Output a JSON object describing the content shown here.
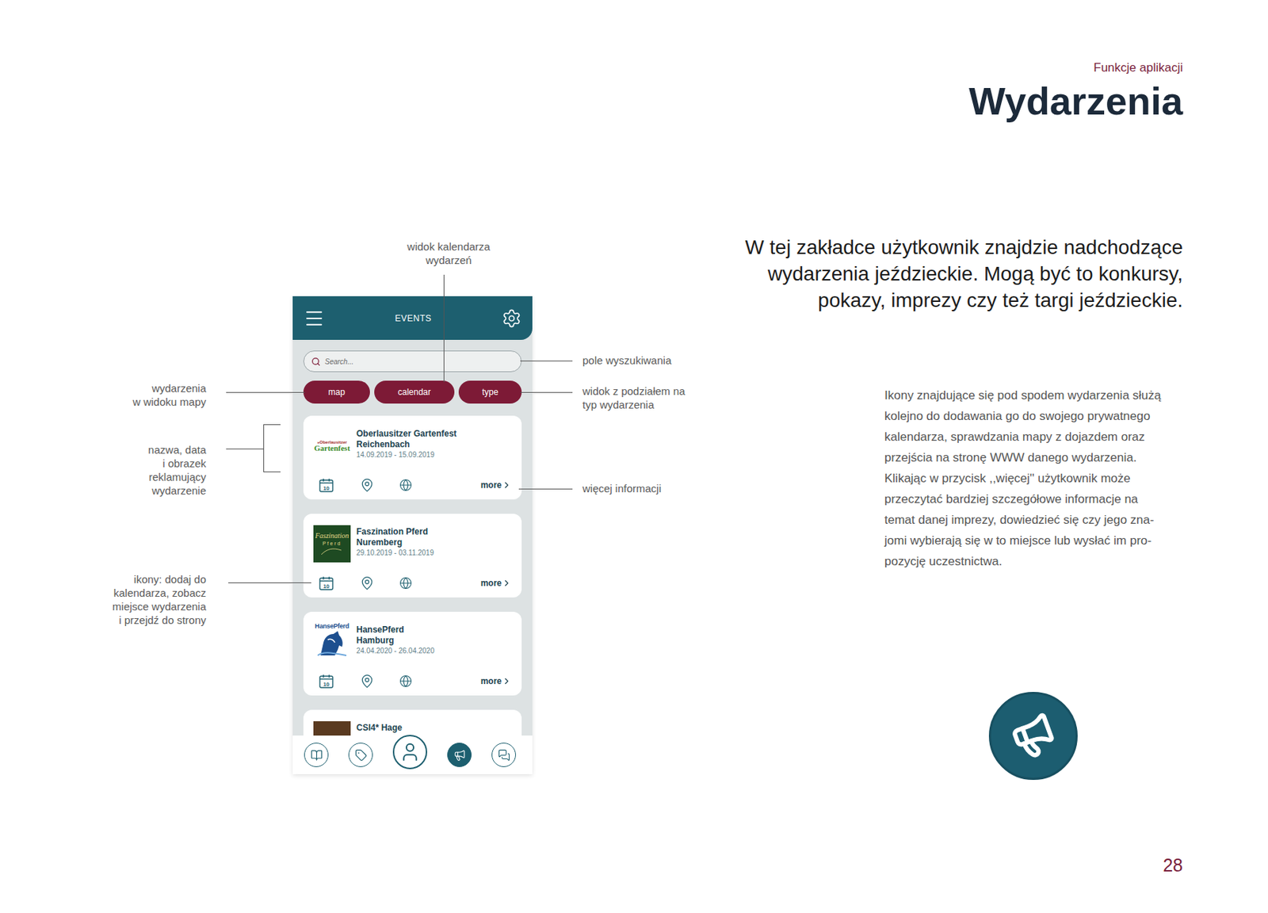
{
  "page": {
    "section": "Funkcje aplikacji",
    "title": "Wydarzenia",
    "number": "28"
  },
  "intro": {
    "headline": [
      "W tej zakładce użytkownik znajdzie nadchodzące",
      "wydarzenia jeździeckie. Mogą być to konkursy,",
      "pokazy, imprezy czy też targi jeździeckie."
    ],
    "paragraph": [
      "Ikony znajdujące się pod spodem wydarzenia służą",
      "kolejno do dodawania go do swojego prywatnego",
      "kalendarza, sprawdzania mapy z dojazdem oraz",
      "przejścia na stronę WWW danego wydarzenia.",
      "Klikając w przycisk ,,więcej'' użytkownik może",
      "przeczytać bardziej szczegółowe informacje na",
      "temat danej imprezy, dowiedzieć się czy jego zna-",
      "jomi wybierają się w to miejsce lub wysłać im pro-",
      "pozycję uczestnictwa."
    ]
  },
  "phone": {
    "header_title": "EVENTS",
    "search": {
      "placeholder": "Search..."
    },
    "filters": [
      {
        "label": "map"
      },
      {
        "label": "calendar"
      },
      {
        "label": "type"
      }
    ],
    "events": [
      {
        "name": "Oberlausitzer Gartenfest",
        "city": "Reichenbach",
        "dates": "14.09.2019 - 15.09.2019",
        "more": "more",
        "calendar_day": "10",
        "logo": {
          "kind": "gartenfest",
          "lines": [
            "»Oberlausitzer",
            "Gartenfest"
          ]
        }
      },
      {
        "name": "Faszination Pferd",
        "city": "Nuremberg",
        "dates": "29.10.2019 - 03.11.2019",
        "more": "more",
        "calendar_day": "10",
        "logo": {
          "kind": "faszination",
          "lines": [
            "Faszination",
            "Pferd"
          ]
        }
      },
      {
        "name": "HansePferd",
        "city": "Hamburg",
        "dates": "24.04.2020 - 26.04.2020",
        "more": "more",
        "calendar_day": "10",
        "logo": {
          "kind": "hansepferd",
          "lines": [
            "HansePferd"
          ]
        }
      }
    ],
    "partial_event": {
      "name": "CSI4* Hage"
    },
    "nav": [
      {
        "kind": "guide",
        "selected": false
      },
      {
        "kind": "offers",
        "selected": false
      },
      {
        "kind": "profile",
        "selected": false
      },
      {
        "kind": "events",
        "selected": true
      },
      {
        "kind": "chat",
        "selected": false
      }
    ]
  },
  "callouts": {
    "calendar": [
      "widok kalendarza",
      "wydarzeń"
    ],
    "search": [
      "pole wyszukiwania"
    ],
    "type": [
      "widok z podziałem na",
      "typ wydarzenia"
    ],
    "more": [
      "więcej informacji"
    ],
    "map": [
      "wydarzenia",
      "w widoku mapy"
    ],
    "card": [
      "nazwa, data",
      "i obrazek",
      "reklamujący",
      "wydarzenie"
    ],
    "icons": [
      "ikony: dodaj do",
      "kalendarza, zobacz",
      "miejsce wydarzenia",
      "i przejdź do strony"
    ]
  }
}
